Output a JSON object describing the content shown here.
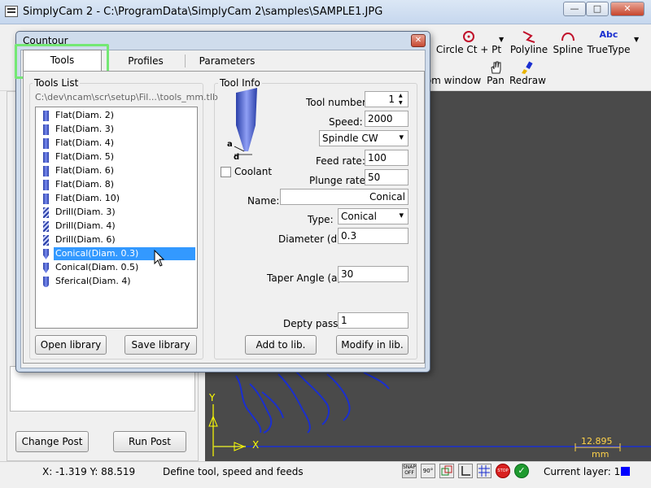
{
  "window": {
    "title": "SimplyCam 2 - C:\\ProgramData\\SimplyCam 2\\samples\\SAMPLE1.JPG",
    "minimize": "—",
    "maximize": "□",
    "close": "✕"
  },
  "toolbar": {
    "circle": "Circle Ct + Pt",
    "polyline": "Polyline",
    "spline": "Spline",
    "truetype": "TrueType",
    "truetype_icon_text": "Abc",
    "zoom_window": "om window",
    "pan": "Pan",
    "redraw": "Redraw"
  },
  "left": {
    "change_post": "Change Post",
    "run_post": "Run Post"
  },
  "canvas": {
    "scale_value": "12.895",
    "scale_unit": "mm",
    "axis_y": "Y",
    "axis_x": "X"
  },
  "status": {
    "coords": "X: -1.319 Y: 88.519",
    "hint": "Define tool, speed and feeds",
    "snap_icon": "SNAP OFF",
    "angle_icon": "90°",
    "stop_icon": "STOP",
    "layer": "Current layer: 1"
  },
  "dialog": {
    "title": "Countour",
    "close": "✕",
    "tabs": [
      "Tools",
      "Profiles",
      "Parameters"
    ],
    "tools_list": {
      "group_label": "Tools List",
      "path": "C:\\dev\\ncam\\scr\\setup\\Fil...\\tools_mm.tlb",
      "items": [
        {
          "label": "Flat(Diam. 2)",
          "kind": "flat"
        },
        {
          "label": "Flat(Diam. 3)",
          "kind": "flat"
        },
        {
          "label": "Flat(Diam. 4)",
          "kind": "flat"
        },
        {
          "label": "Flat(Diam. 5)",
          "kind": "flat"
        },
        {
          "label": "Flat(Diam. 6)",
          "kind": "flat"
        },
        {
          "label": "Flat(Diam. 8)",
          "kind": "flat"
        },
        {
          "label": "Flat(Diam. 10)",
          "kind": "flat"
        },
        {
          "label": "Drill(Diam. 3)",
          "kind": "drill"
        },
        {
          "label": "Drill(Diam. 4)",
          "kind": "drill"
        },
        {
          "label": "Drill(Diam. 6)",
          "kind": "drill"
        },
        {
          "label": "Conical(Diam. 0.3)",
          "kind": "conical",
          "selected": true
        },
        {
          "label": "Conical(Diam. 0.5)",
          "kind": "conical"
        },
        {
          "label": "Sferical(Diam. 4)",
          "kind": "sferical"
        }
      ],
      "open_library": "Open library",
      "save_library": "Save library"
    },
    "tool_info": {
      "group_label": "Tool Info",
      "diagram_a": "a",
      "diagram_d": "d",
      "coolant_label": "Coolant",
      "coolant_checked": false,
      "tool_number_label": "Tool number:",
      "tool_number": "1",
      "speed_label": "Speed:",
      "speed": "2000",
      "spindle": "Spindle CW",
      "feed_rate_label": "Feed rate:",
      "feed_rate": "100",
      "plunge_rate_label": "Plunge rate:",
      "plunge_rate": "50",
      "name_label": "Name:",
      "name": "Conical",
      "type_label": "Type:",
      "type": "Conical",
      "diameter_label": "Diameter (d):",
      "diameter": "0.3",
      "taper_label": "Taper Angle (a):",
      "taper": "30",
      "depth_label": "Depty pass:",
      "depth": "1",
      "add_to_lib": "Add to lib.",
      "modify_in_lib": "Modify in lib."
    }
  },
  "colors": {
    "canvas_bg": "#4a4a4a",
    "drawing": "#1a2fd0",
    "axis": "#ffff00",
    "selection": "#3399ff",
    "tab_highlight": "#74e874",
    "layer": "#0000ff"
  }
}
